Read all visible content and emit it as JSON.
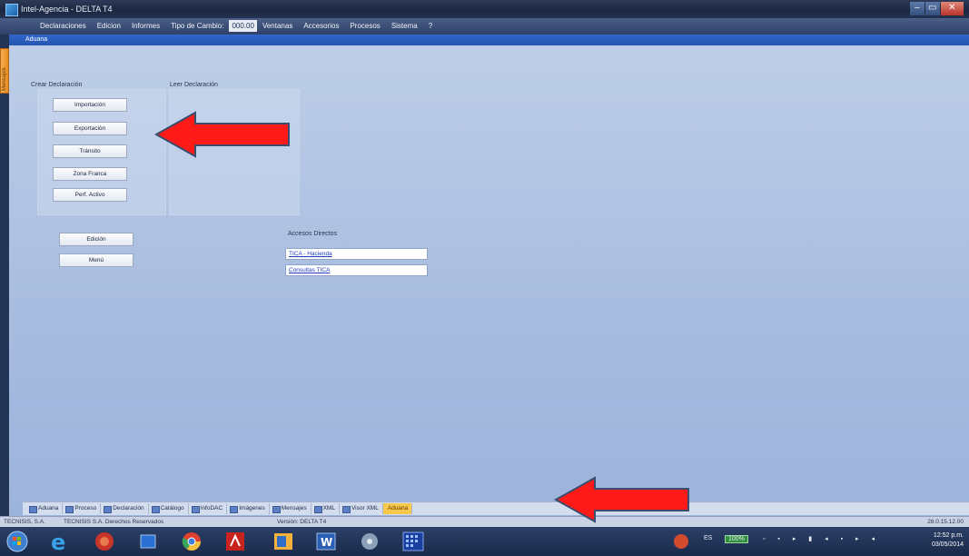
{
  "window": {
    "title": "Intel-Agencia - DELTA T4",
    "min": "–",
    "max": "▭",
    "close": "✕"
  },
  "menu": [
    {
      "label": "Declaraciones"
    },
    {
      "label": "Edicion"
    },
    {
      "label": "Informes"
    },
    {
      "label": "Tipo de Cambio:"
    },
    {
      "label": "000.00",
      "highlight": true
    },
    {
      "label": "Ventanas"
    },
    {
      "label": "Accesorios"
    },
    {
      "label": "Procesos"
    },
    {
      "label": "Sistema"
    },
    {
      "label": "?"
    }
  ],
  "side_tab": "Mensajes",
  "doc": {
    "title": "Aduana"
  },
  "crear": {
    "label": "Crear Declaración",
    "buttons": [
      "Importación",
      "Exportación",
      "Tránsito",
      "Zona Franca",
      "Perf. Activo"
    ]
  },
  "leer": {
    "label": "Leer Declaración"
  },
  "actions": {
    "buttons": [
      "Edición",
      "Menú"
    ]
  },
  "accesos": {
    "label": "Accesos Directos",
    "links": [
      "TICA - Hacienda",
      "Consultas TICA"
    ]
  },
  "bottom_tabs": [
    {
      "label": "Aduana",
      "icon": "folder-icon"
    },
    {
      "label": "Proceso",
      "icon": "document-icon"
    },
    {
      "label": "Declaración",
      "icon": "document-icon"
    },
    {
      "label": "Catálogo",
      "icon": "list-icon"
    },
    {
      "label": "InfoDAC",
      "icon": "document-icon"
    },
    {
      "label": "Imágenes",
      "icon": "image-icon"
    },
    {
      "label": "Mensajes",
      "icon": "message-icon"
    },
    {
      "label": "XML",
      "icon": "xml-icon"
    },
    {
      "label": "Visor XML",
      "icon": "xml-icon"
    },
    {
      "label": "Aduana",
      "active": true
    }
  ],
  "status": {
    "left": "TECNISIS, S.A.",
    "copyright": "TECNISIS S.A. Derechos Reservados",
    "version": "Versión: DELTA T4",
    "right": "28.0.15.12.00"
  },
  "taskbar": {
    "apps": [
      "start-orb-icon",
      "ie-icon",
      "app-icon",
      "media-icon",
      "chrome-icon",
      "acrobat-icon",
      "outlook-icon",
      "word-icon",
      "app2-icon",
      "delta-app-icon"
    ],
    "lang": "ES",
    "battery": "100%",
    "time": "12:52 p.m.",
    "date": "03/05/2014"
  },
  "colors": {
    "arrow": "#ff0000",
    "accent": "#2f66c9",
    "active_tab": "#f6c84c"
  }
}
